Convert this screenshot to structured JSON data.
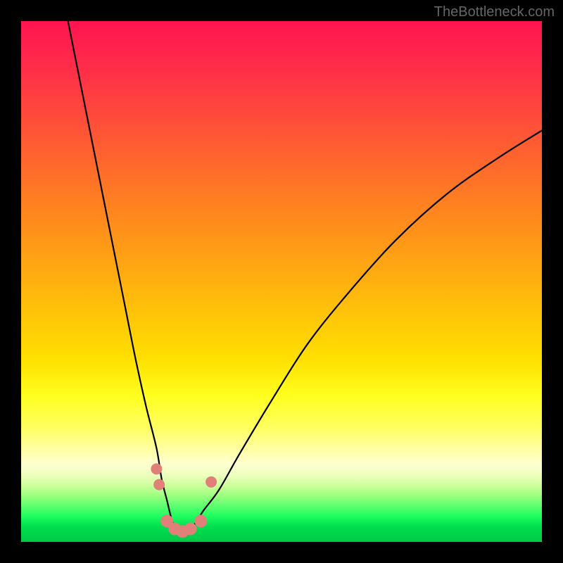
{
  "watermark": "TheBottleneck.com",
  "chart_data": {
    "type": "line",
    "title": "",
    "xlabel": "",
    "ylabel": "",
    "xlim": [
      0,
      100
    ],
    "ylim": [
      0,
      100
    ],
    "grid": false,
    "legend": false,
    "annotations": [],
    "series": [
      {
        "name": "bottleneck-curve",
        "color": "#000000",
        "x": [
          9,
          12,
          15,
          18,
          20,
          22,
          24,
          26,
          27,
          28,
          29,
          30,
          31,
          33,
          35,
          38,
          42,
          48,
          55,
          63,
          72,
          82,
          92,
          100
        ],
        "y": [
          100,
          85,
          70,
          55,
          45,
          35,
          26,
          18,
          12,
          8,
          4,
          2,
          2,
          3,
          6,
          10,
          17,
          27,
          38,
          48,
          58,
          67,
          74,
          79
        ]
      }
    ],
    "markers": [
      {
        "x": 26.0,
        "y": 14.0,
        "color": "#e08078",
        "r": 8
      },
      {
        "x": 26.5,
        "y": 11.0,
        "color": "#e08078",
        "r": 8
      },
      {
        "x": 28.0,
        "y": 4.0,
        "color": "#e08078",
        "r": 9
      },
      {
        "x": 29.5,
        "y": 2.5,
        "color": "#e08078",
        "r": 9
      },
      {
        "x": 31.0,
        "y": 2.0,
        "color": "#e08078",
        "r": 9
      },
      {
        "x": 32.5,
        "y": 2.5,
        "color": "#e08078",
        "r": 9
      },
      {
        "x": 34.5,
        "y": 4.0,
        "color": "#e08078",
        "r": 9
      },
      {
        "x": 36.5,
        "y": 11.5,
        "color": "#e08078",
        "r": 8
      }
    ],
    "gradient_stops": [
      {
        "pos": 0.0,
        "color": "#ff1450"
      },
      {
        "pos": 0.5,
        "color": "#ffc00a"
      },
      {
        "pos": 0.75,
        "color": "#ffff40"
      },
      {
        "pos": 0.88,
        "color": "#e0ffb0"
      },
      {
        "pos": 1.0,
        "color": "#00c848"
      }
    ]
  }
}
